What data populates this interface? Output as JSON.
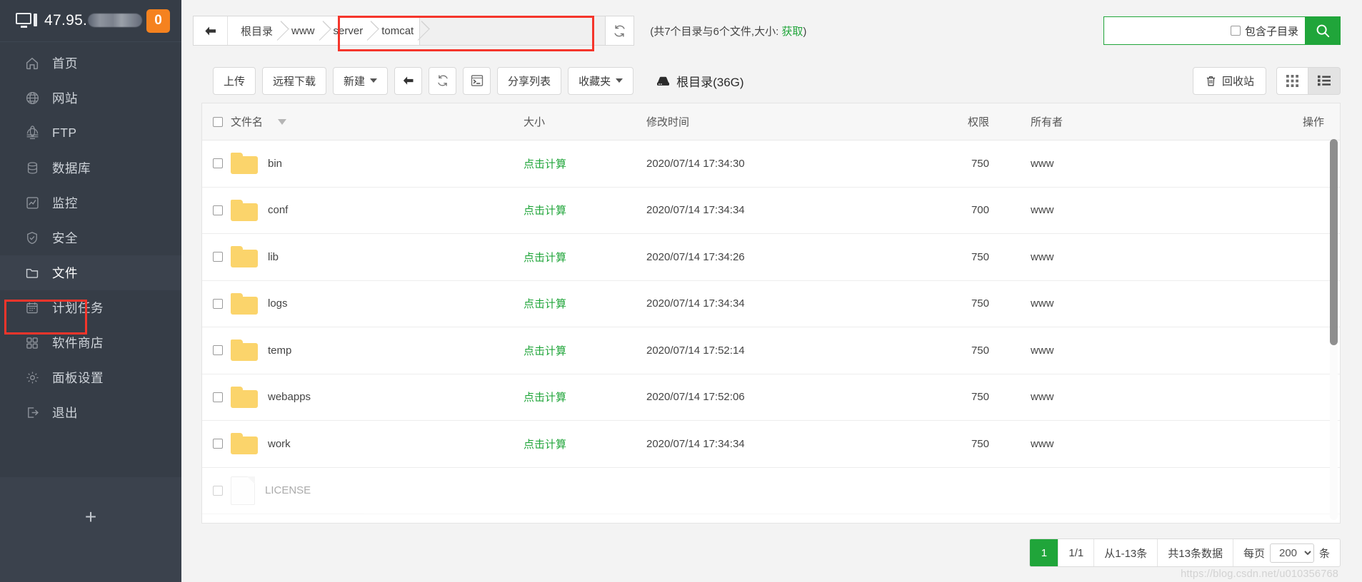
{
  "sidebar": {
    "host_ip": "47.95.",
    "notification_count": "0",
    "items": [
      {
        "label": "首页",
        "icon": "home-icon"
      },
      {
        "label": "网站",
        "icon": "globe-icon"
      },
      {
        "label": "FTP",
        "icon": "ftp-icon"
      },
      {
        "label": "数据库",
        "icon": "database-icon"
      },
      {
        "label": "监控",
        "icon": "monitor-chart-icon"
      },
      {
        "label": "安全",
        "icon": "shield-icon"
      },
      {
        "label": "文件",
        "icon": "folder-icon",
        "active": true
      },
      {
        "label": "计划任务",
        "icon": "calendar-icon"
      },
      {
        "label": "软件商店",
        "icon": "grid-apps-icon"
      },
      {
        "label": "面板设置",
        "icon": "gear-icon"
      },
      {
        "label": "退出",
        "icon": "logout-icon"
      }
    ],
    "add_button": "+"
  },
  "pathbar": {
    "back_icon": "arrow-left-icon",
    "crumbs": [
      "根目录",
      "www",
      "server",
      "tomcat"
    ],
    "path_value": "",
    "path_placeholder": "",
    "refresh_icon": "refresh-icon",
    "dir_count_prefix": "(共7个目录与6个文件,大小: ",
    "dir_count_link": "获取",
    "dir_count_suffix": ")"
  },
  "search": {
    "value": "",
    "placeholder": "",
    "subdir_label": "包含子目录",
    "subdir_checked": false,
    "button_icon": "search-icon"
  },
  "toolbar": {
    "upload": "上传",
    "remote_download": "远程下载",
    "new": "新建",
    "back_icon": "arrow-left-icon",
    "refresh_icon": "refresh-icon",
    "terminal_icon": "terminal-icon",
    "share_list": "分享列表",
    "favorites": "收藏夹",
    "root_label": "根目录(36G)",
    "root_icon": "disk-icon",
    "recycle_bin": "回收站",
    "recycle_icon": "trash-icon",
    "view_grid_icon": "grid-view-icon",
    "view_list_icon": "list-view-icon",
    "active_view": "list"
  },
  "table": {
    "select_all_checked": false,
    "columns": [
      "文件名",
      "大小",
      "修改时间",
      "权限",
      "所有者",
      "操作"
    ],
    "sort_column": "文件名",
    "sort_icon": "caret-down-icon",
    "size_action_label": "点击计算",
    "rows": [
      {
        "name": "bin",
        "type": "folder",
        "size": "点击计算",
        "mtime": "2020/07/14 17:34:30",
        "perm": "750",
        "owner": "www"
      },
      {
        "name": "conf",
        "type": "folder",
        "size": "点击计算",
        "mtime": "2020/07/14 17:34:34",
        "perm": "700",
        "owner": "www"
      },
      {
        "name": "lib",
        "type": "folder",
        "size": "点击计算",
        "mtime": "2020/07/14 17:34:26",
        "perm": "750",
        "owner": "www"
      },
      {
        "name": "logs",
        "type": "folder",
        "size": "点击计算",
        "mtime": "2020/07/14 17:34:34",
        "perm": "750",
        "owner": "www"
      },
      {
        "name": "temp",
        "type": "folder",
        "size": "点击计算",
        "mtime": "2020/07/14 17:52:14",
        "perm": "750",
        "owner": "www"
      },
      {
        "name": "webapps",
        "type": "folder",
        "size": "点击计算",
        "mtime": "2020/07/14 17:52:06",
        "perm": "750",
        "owner": "www"
      },
      {
        "name": "work",
        "type": "folder",
        "size": "点击计算",
        "mtime": "2020/07/14 17:34:34",
        "perm": "750",
        "owner": "www"
      },
      {
        "name": "LICENSE",
        "type": "file",
        "size": "",
        "mtime": "",
        "perm": "",
        "owner": ""
      }
    ]
  },
  "pagination": {
    "current_page": "1",
    "page_of": "1/1",
    "range": "从1-13条",
    "total": "共13条数据",
    "per_page_prefix": "每页",
    "per_page_value": "200",
    "per_page_suffix": "条"
  },
  "watermark": "https://blog.csdn.net/u010356768",
  "colors": {
    "accent_green": "#20a53a",
    "sidebar_bg": "#363d47",
    "badge_orange": "#f5821f",
    "highlight_red": "#f5352b",
    "folder_yellow": "#fbd46b"
  }
}
